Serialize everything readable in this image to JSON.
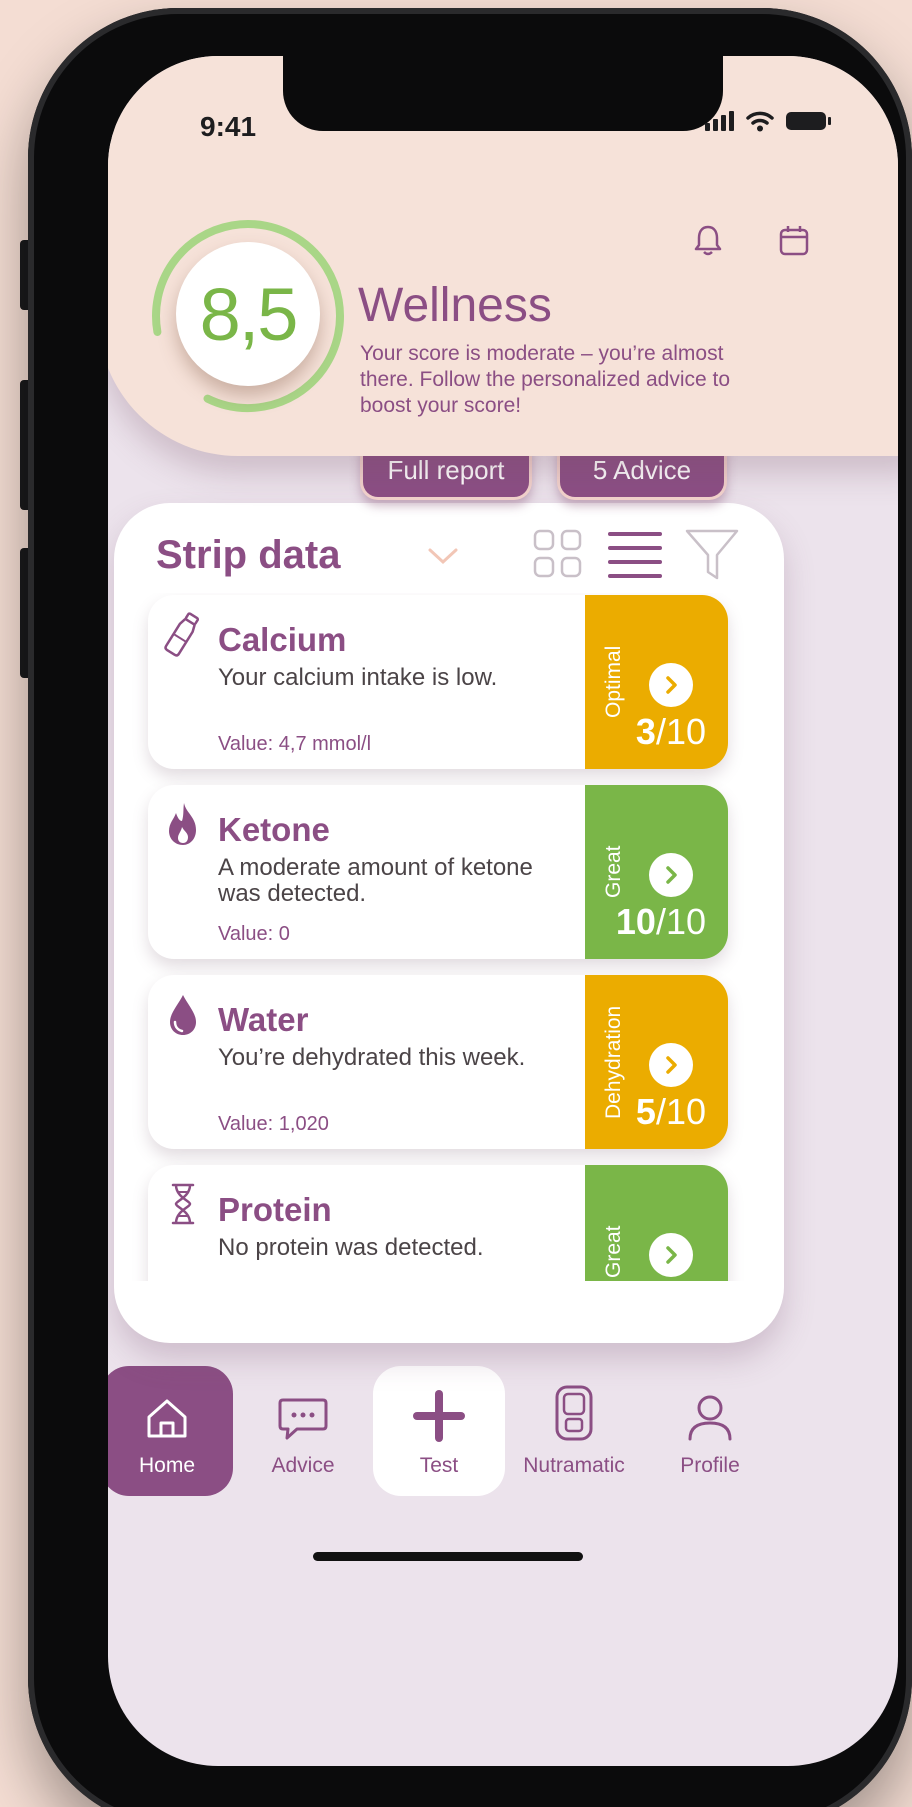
{
  "status_bar": {
    "time": "9:41"
  },
  "header": {
    "score": "8,5",
    "title": "Wellness",
    "description": "Your score is moderate – you’re almost there. Follow the personalized advice to boost your score!",
    "score_ring_fraction": 0.85,
    "icons": [
      "bell-icon",
      "calendar-icon"
    ]
  },
  "actions": {
    "full_report": "Full report",
    "advice": "5 Advice"
  },
  "strip_data": {
    "title": "Strip data",
    "items": [
      {
        "name": "Calcium",
        "text": "Your calcium intake is low.",
        "value": "Value: 4,7 mmol/l",
        "status": "Optimal",
        "score": "3",
        "max": "/10",
        "color": "#ebac00",
        "icon": "bottle-icon"
      },
      {
        "name": "Ketone",
        "text": "A moderate amount of ketone was detected.",
        "value": "Value: 0",
        "status": "Great",
        "score": "10",
        "max": "/10",
        "color": "#7ab648",
        "icon": "flame-icon"
      },
      {
        "name": "Water",
        "text": "You’re dehydrated this week.",
        "value": "Value: 1,020",
        "status": "Dehydration",
        "score": "5",
        "max": "/10",
        "color": "#ebac00",
        "icon": "drop-icon"
      },
      {
        "name": "Protein",
        "text": "No protein was detected.",
        "value": "",
        "status": "Great",
        "score": "",
        "max": "",
        "color": "#7ab648",
        "icon": "dna-icon"
      }
    ]
  },
  "tabs": [
    {
      "label": "Home",
      "icon": "home-icon",
      "active": true
    },
    {
      "label": "Advice",
      "icon": "chat-icon"
    },
    {
      "label": "Test",
      "icon": "plus-icon"
    },
    {
      "label": "Nutramatic",
      "icon": "device-icon"
    },
    {
      "label": "Profile",
      "icon": "user-icon"
    }
  ],
  "colors": {
    "brand": "#8b4e84",
    "ok": "#7ab648",
    "warn": "#ebac00",
    "header_bg": "#f6e2d9"
  }
}
